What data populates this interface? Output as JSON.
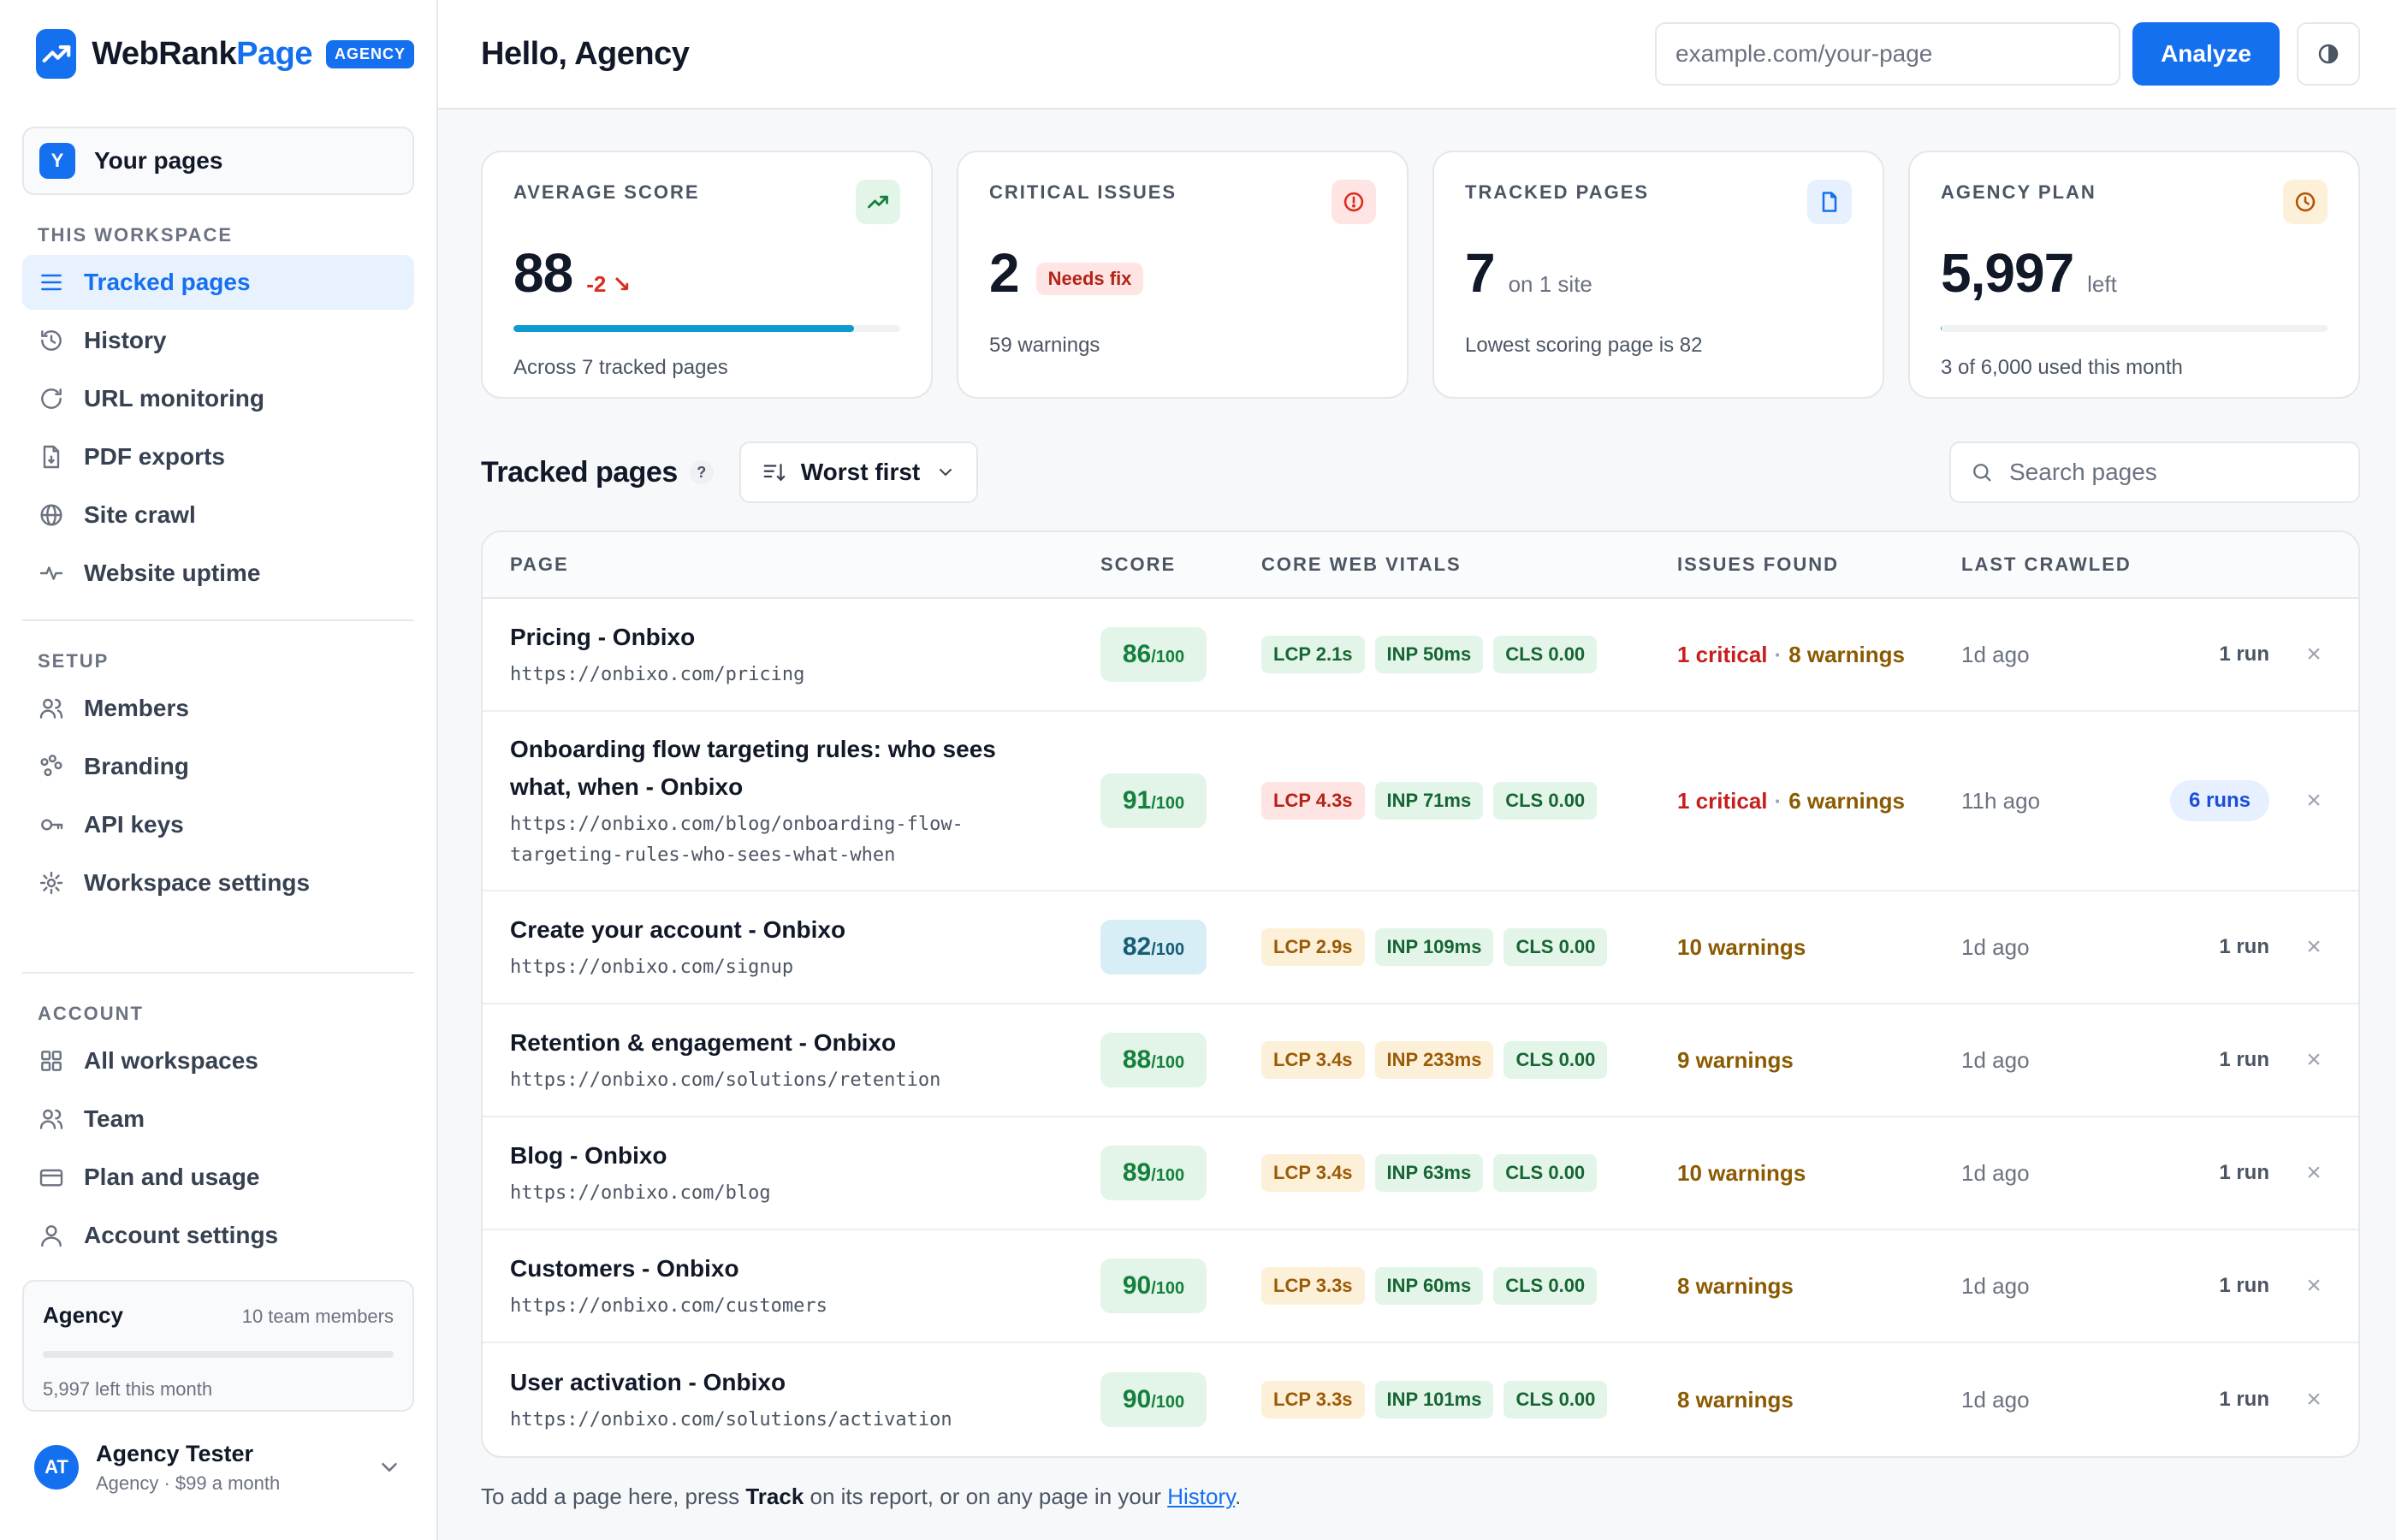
{
  "brand": {
    "name_part1": "WebRank",
    "name_part2": "Page",
    "badge": "AGENCY"
  },
  "sidebar": {
    "pages_switcher": {
      "avatar": "Y",
      "label": "Your pages"
    },
    "workspace_title": "THIS WORKSPACE",
    "workspace_items": [
      {
        "label": "Tracked pages",
        "icon": "list-icon",
        "active": true
      },
      {
        "label": "History",
        "icon": "history-icon"
      },
      {
        "label": "URL monitoring",
        "icon": "refresh-icon"
      },
      {
        "label": "PDF exports",
        "icon": "pdf-icon"
      },
      {
        "label": "Site crawl",
        "icon": "globe-icon"
      },
      {
        "label": "Website uptime",
        "icon": "pulse-icon"
      }
    ],
    "setup_title": "SETUP",
    "setup_items": [
      {
        "label": "Members",
        "icon": "users-icon"
      },
      {
        "label": "Branding",
        "icon": "palette-icon"
      },
      {
        "label": "API keys",
        "icon": "key-icon"
      },
      {
        "label": "Workspace settings",
        "icon": "gear-icon"
      }
    ],
    "account_title": "ACCOUNT",
    "account_items": [
      {
        "label": "All workspaces",
        "icon": "grid-icon"
      },
      {
        "label": "Team",
        "icon": "team-icon"
      },
      {
        "label": "Plan and usage",
        "icon": "card-icon"
      },
      {
        "label": "Account settings",
        "icon": "user-icon"
      }
    ],
    "plan": {
      "name": "Agency",
      "members": "10 team members",
      "left": "5,997 left this month",
      "used_fraction": 0.0005
    },
    "user": {
      "initials": "AT",
      "name": "Agency Tester",
      "sub": "Agency · $99 a month"
    }
  },
  "topbar": {
    "greeting": "Hello, Agency",
    "url_placeholder": "example.com/your-page",
    "analyze_label": "Analyze"
  },
  "stats": {
    "avg": {
      "label": "AVERAGE SCORE",
      "value": "88",
      "delta": "-2 ↘",
      "progress": 0.88,
      "foot": "Across 7 tracked pages"
    },
    "critical": {
      "label": "CRITICAL ISSUES",
      "value": "2",
      "pill": "Needs fix",
      "foot": "59 warnings"
    },
    "tracked": {
      "label": "TRACKED PAGES",
      "value": "7",
      "suffix": "on 1 site",
      "foot": "Lowest scoring page is 82"
    },
    "plan": {
      "label": "AGENCY PLAN",
      "value": "5,997",
      "suffix": "left",
      "progress": 0.0005,
      "foot": "3 of 6,000 used this month"
    }
  },
  "list": {
    "title": "Tracked pages",
    "help": "?",
    "sort_label": "Worst first",
    "search_placeholder": "Search pages",
    "columns": {
      "page": "PAGE",
      "score": "SCORE",
      "cwv": "CORE WEB VITALS",
      "issues": "ISSUES FOUND",
      "crawl": "LAST CRAWLED"
    },
    "rows": [
      {
        "title": "Pricing - Onbixo",
        "url": "https://onbixo.com/pricing",
        "score": "86",
        "out": "/100",
        "lcp": "2.1s",
        "lcp_s": "good",
        "inp": "50ms",
        "inp_s": "good",
        "cls": "0.00",
        "critical": "1 critical",
        "warnings": "8 warnings",
        "crawled": "1d ago",
        "runs": "1 run"
      },
      {
        "title": "Onboarding flow targeting rules: who sees what, when - Onbixo",
        "url": "https://onbixo.com/blog/onboarding-flow-targeting-rules-who-sees-what-when",
        "score": "91",
        "out": "/100",
        "lcp": "4.3s",
        "lcp_s": "bad",
        "inp": "71ms",
        "inp_s": "good",
        "cls": "0.00",
        "critical": "1 critical",
        "warnings": "6 warnings",
        "crawled": "11h ago",
        "runs": "6 runs",
        "runs_pill": true
      },
      {
        "title": "Create your account - Onbixo",
        "url": "https://onbixo.com/signup",
        "score": "82",
        "out": "/100",
        "score_mid": true,
        "lcp": "2.9s",
        "lcp_s": "warn",
        "inp": "109ms",
        "inp_s": "good",
        "cls": "0.00",
        "critical": "",
        "warnings": "10 warnings",
        "crawled": "1d ago",
        "runs": "1 run"
      },
      {
        "title": "Retention & engagement - Onbixo",
        "url": "https://onbixo.com/solutions/retention",
        "score": "88",
        "out": "/100",
        "lcp": "3.4s",
        "lcp_s": "warn",
        "inp": "233ms",
        "inp_s": "warn",
        "cls": "0.00",
        "critical": "",
        "warnings": "9 warnings",
        "crawled": "1d ago",
        "runs": "1 run"
      },
      {
        "title": "Blog - Onbixo",
        "url": "https://onbixo.com/blog",
        "score": "89",
        "out": "/100",
        "lcp": "3.4s",
        "lcp_s": "warn",
        "inp": "63ms",
        "inp_s": "good",
        "cls": "0.00",
        "critical": "",
        "warnings": "10 warnings",
        "crawled": "1d ago",
        "runs": "1 run"
      },
      {
        "title": "Customers - Onbixo",
        "url": "https://onbixo.com/customers",
        "score": "90",
        "out": "/100",
        "lcp": "3.3s",
        "lcp_s": "warn",
        "inp": "60ms",
        "inp_s": "good",
        "cls": "0.00",
        "critical": "",
        "warnings": "8 warnings",
        "crawled": "1d ago",
        "runs": "1 run"
      },
      {
        "title": "User activation - Onbixo",
        "url": "https://onbixo.com/solutions/activation",
        "score": "90",
        "out": "/100",
        "lcp": "3.3s",
        "lcp_s": "warn",
        "inp": "101ms",
        "inp_s": "good",
        "cls": "0.00",
        "critical": "",
        "warnings": "8 warnings",
        "crawled": "1d ago",
        "runs": "1 run"
      }
    ],
    "footer_pre": "To add a page here, press ",
    "footer_bold": "Track",
    "footer_mid": " on its report, or on any page in your ",
    "footer_link": "History",
    "footer_end": "."
  },
  "colors": {
    "accent": "#1570ef",
    "good": "#15803d",
    "warn": "#9a5b06",
    "bad": "#b42318"
  }
}
